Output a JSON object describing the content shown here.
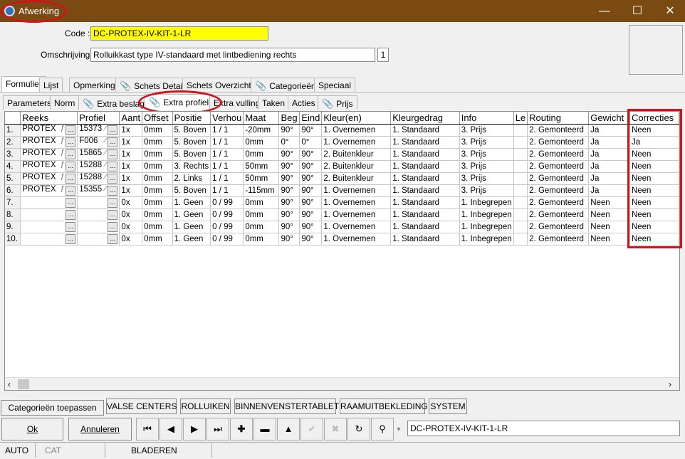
{
  "window": {
    "title": "Afwerking",
    "minimize": "—",
    "maximize": "☐",
    "close": "✕"
  },
  "header": {
    "code_label": "Code :",
    "code_value": "DC-PROTEX-IV-KIT-1-LR",
    "desc_label": "Omschrijving :",
    "desc_value": "Rolluikkast type IV-standaard met lintbediening rechts",
    "desc_counter": "1"
  },
  "main_tabs": [
    "Formulier",
    "Lijst",
    "Opmerking",
    "Schets Detail",
    "Schets Overzicht",
    "Categorieën",
    "Speciaal"
  ],
  "sub_tabs": [
    "Parameters",
    "Norm",
    "Extra beslag",
    "Extra profiel",
    "Extra vulling",
    "Taken",
    "Acties",
    "Prijs"
  ],
  "columns": [
    "",
    "Reeks",
    "Profiel",
    "Aant",
    "Offset",
    "Positie",
    "Verhou",
    "Maat",
    "Beg",
    "Eind",
    "Kleur(en)",
    "Kleurgedrag",
    "Info",
    "Le",
    "Routing",
    "Gewicht",
    "Correcties"
  ],
  "rows": [
    [
      "1.",
      "PROTEX",
      "15373",
      "1x",
      "0mm",
      "5. Boven",
      "1 / 1",
      "-20mm",
      "90°",
      "90°",
      "1. Overnemen",
      "1. Standaard",
      "3. Prijs",
      "",
      "2. Gemonteerd",
      "Ja",
      "Neen"
    ],
    [
      "2.",
      "PROTEX",
      "F006",
      "1x",
      "0mm",
      "5. Boven",
      "1 / 1",
      "0mm",
      "0°",
      "0°",
      "1. Overnemen",
      "1. Standaard",
      "3. Prijs",
      "",
      "2. Gemonteerd",
      "Ja",
      "Ja"
    ],
    [
      "3.",
      "PROTEX",
      "15865",
      "1x",
      "0mm",
      "5. Boven",
      "1 / 1",
      "0mm",
      "90°",
      "90°",
      "2. Buitenkleur",
      "1. Standaard",
      "3. Prijs",
      "",
      "2. Gemonteerd",
      "Ja",
      "Neen"
    ],
    [
      "4.",
      "PROTEX",
      "15288",
      "1x",
      "0mm",
      "3. Rechts",
      "1 / 1",
      "50mm",
      "90°",
      "90°",
      "2. Buitenkleur",
      "1. Standaard",
      "3. Prijs",
      "",
      "2. Gemonteerd",
      "Ja",
      "Neen"
    ],
    [
      "5.",
      "PROTEX",
      "15288",
      "1x",
      "0mm",
      "2. Links",
      "1 / 1",
      "50mm",
      "90°",
      "90°",
      "2. Buitenkleur",
      "1. Standaard",
      "3. Prijs",
      "",
      "2. Gemonteerd",
      "Ja",
      "Neen"
    ],
    [
      "6.",
      "PROTEX",
      "15355",
      "1x",
      "0mm",
      "5. Boven",
      "1 / 1",
      "-115mm",
      "90°",
      "90°",
      "1. Overnemen",
      "1. Standaard",
      "3. Prijs",
      "",
      "2. Gemonteerd",
      "Ja",
      "Neen"
    ],
    [
      "7.",
      "",
      "",
      "0x",
      "0mm",
      "1. Geen",
      "0 / 99",
      "0mm",
      "90°",
      "90°",
      "1. Overnemen",
      "1. Standaard",
      "1. Inbegrepen",
      "",
      "2. Gemonteerd",
      "Neen",
      "Neen"
    ],
    [
      "8.",
      "",
      "",
      "0x",
      "0mm",
      "1. Geen",
      "0 / 99",
      "0mm",
      "90°",
      "90°",
      "1. Overnemen",
      "1. Standaard",
      "1. Inbegrepen",
      "",
      "2. Gemonteerd",
      "Neen",
      "Neen"
    ],
    [
      "9.",
      "",
      "",
      "0x",
      "0mm",
      "1. Geen",
      "0 / 99",
      "0mm",
      "90°",
      "90°",
      "1. Overnemen",
      "1. Standaard",
      "1. Inbegrepen",
      "",
      "2. Gemonteerd",
      "Neen",
      "Neen"
    ],
    [
      "10.",
      "",
      "",
      "0x",
      "0mm",
      "1. Geen",
      "0 / 99",
      "0mm",
      "90°",
      "90°",
      "1. Overnemen",
      "1. Standaard",
      "1. Inbegrepen",
      "",
      "2. Gemonteerd",
      "Neen",
      "Neen"
    ]
  ],
  "category_buttons": [
    "Categorieën toepassen",
    "VALSE CENTERS",
    "ROLLUIKEN",
    "BINNENVENSTERTABLET",
    "RAAMUITBEKLEDING",
    "SYSTEM"
  ],
  "actions": {
    "ok": "Ok",
    "cancel": "Annuleren"
  },
  "search_value": "DC-PROTEX-IV-KIT-1-LR",
  "status": {
    "auto": "AUTO",
    "cat": "CAT",
    "mode": "BLADEREN"
  },
  "colors": {
    "titlebar": "#7a4a12",
    "code_bg": "#ffff00",
    "highlight": "#d0141a"
  }
}
